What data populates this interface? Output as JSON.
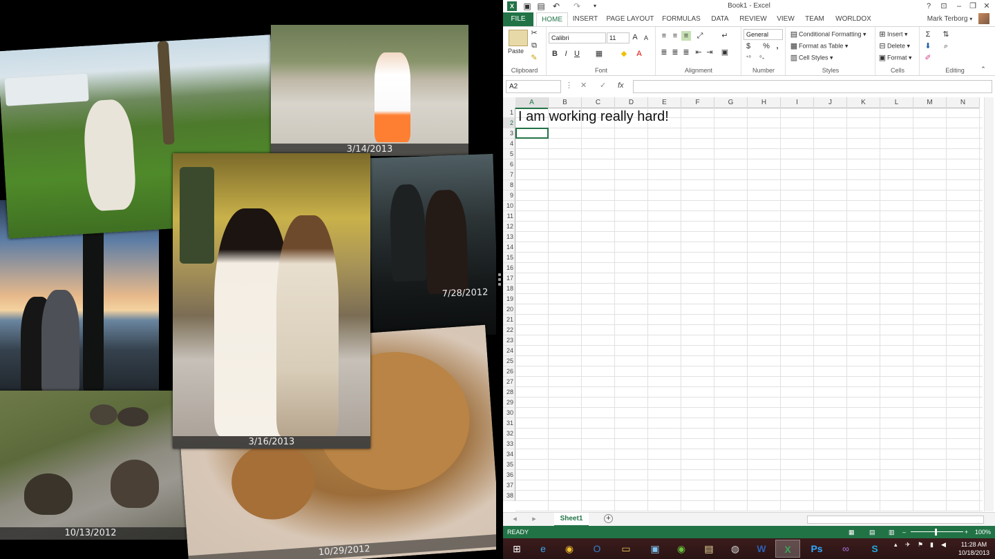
{
  "collage": {
    "photos": [
      {
        "caption": "3/16/2013"
      },
      {
        "caption": "3/14/2013"
      },
      {
        "caption": "3/16/2013"
      },
      {
        "caption": "7/28/2012"
      },
      {
        "caption": "10/13/2012"
      },
      {
        "caption": "10/29/2012"
      }
    ]
  },
  "excel": {
    "window_title": "Book1 - Excel",
    "title_buttons": [
      "?",
      "⊡",
      "–",
      "❐",
      "✕"
    ],
    "tabs": [
      "FILE",
      "HOME",
      "INSERT",
      "PAGE LAYOUT",
      "FORMULAS",
      "DATA",
      "REVIEW",
      "VIEW",
      "TEAM",
      "WORLDOX"
    ],
    "account_name": "Mark Terborg",
    "ribbon": {
      "clipboard": {
        "label": "Clipboard",
        "paste": "Paste"
      },
      "font": {
        "label": "Font",
        "name": "Calibri",
        "size": "11",
        "bold": "B",
        "italic": "I",
        "underline": "U",
        "grow": "A",
        "shrink": "A"
      },
      "alignment": {
        "label": "Alignment"
      },
      "number": {
        "label": "Number",
        "format": "General",
        "currency": "$",
        "percent": "%",
        "comma": ","
      },
      "styles": {
        "label": "Styles",
        "conditional": "Conditional Formatting",
        "format_table": "Format as Table",
        "cell_styles": "Cell Styles"
      },
      "cells": {
        "label": "Cells",
        "insert": "Insert",
        "delete": "Delete",
        "format": "Format"
      },
      "editing": {
        "label": "Editing"
      }
    },
    "name_box": "A2",
    "fx": "fx",
    "columns": [
      "A",
      "B",
      "C",
      "D",
      "E",
      "F",
      "G",
      "H",
      "I",
      "J",
      "K",
      "L",
      "M",
      "N"
    ],
    "rows": [
      "1",
      "2",
      "3",
      "4",
      "5",
      "6",
      "7",
      "8",
      "9",
      "10",
      "11",
      "12",
      "13",
      "14",
      "15",
      "16",
      "17",
      "18",
      "19",
      "20",
      "21",
      "22",
      "23",
      "24",
      "25",
      "26",
      "27",
      "28",
      "29",
      "30",
      "31",
      "32",
      "33",
      "34",
      "35",
      "36",
      "37",
      "38"
    ],
    "cell_a1": "I am working really hard!",
    "sheet_tab": "Sheet1",
    "status": "READY",
    "zoom": "100%"
  },
  "taskbar": {
    "time": "11:28 AM",
    "date": "10/18/2013"
  }
}
